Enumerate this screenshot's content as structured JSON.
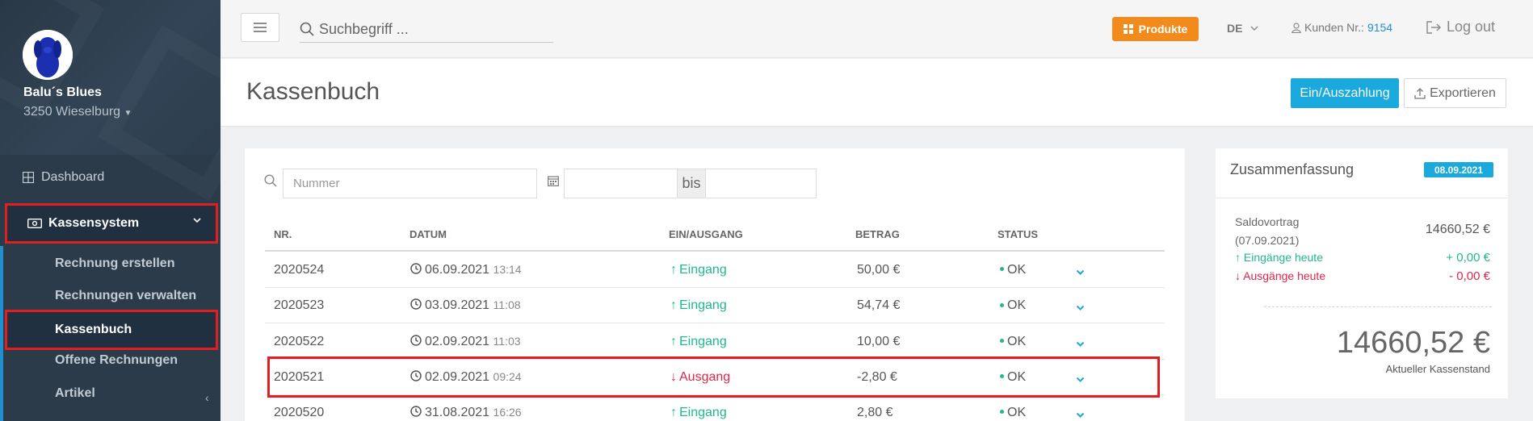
{
  "sidebar": {
    "shop_name": "Balu´s Blues",
    "shop_location": "3250 Wieselburg",
    "dashboard_label": "Dashboard",
    "kassensystem_label": "Kassensystem",
    "sub_items": [
      {
        "label": "Rechnung erstellen"
      },
      {
        "label": "Rechnungen verwalten"
      },
      {
        "label": "Kassenbuch"
      },
      {
        "label": "Offene Rechnungen"
      },
      {
        "label": "Artikel"
      }
    ]
  },
  "topbar": {
    "search_placeholder": "Suchbegriff ...",
    "produkte_label": "Produkte",
    "language": "DE",
    "kunden_label": "Kunden Nr.:",
    "kunden_nr": "9154",
    "logout_label": "Log out"
  },
  "page": {
    "title": "Kassenbuch",
    "ein_auszahlung_label": "Ein/Auszahlung",
    "exportieren_label": "Exportieren"
  },
  "filters": {
    "nummer_placeholder": "Nummer",
    "bis_label": "bis"
  },
  "table": {
    "columns": [
      "NR.",
      "DATUM",
      "EIN/AUSGANG",
      "BETRAG",
      "STATUS"
    ],
    "rows": [
      {
        "nr": "2020524",
        "date": "06.09.2021",
        "time": "13:14",
        "type": "Eingang",
        "direction": "in",
        "amount": "50,00 €",
        "status": "OK"
      },
      {
        "nr": "2020523",
        "date": "03.09.2021",
        "time": "11:08",
        "type": "Eingang",
        "direction": "in",
        "amount": "54,74 €",
        "status": "OK"
      },
      {
        "nr": "2020522",
        "date": "02.09.2021",
        "time": "11:03",
        "type": "Eingang",
        "direction": "in",
        "amount": "10,00 €",
        "status": "OK"
      },
      {
        "nr": "2020521",
        "date": "02.09.2021",
        "time": "09:24",
        "type": "Ausgang",
        "direction": "out",
        "amount": "-2,80 €",
        "status": "OK"
      },
      {
        "nr": "2020520",
        "date": "31.08.2021",
        "time": "16:26",
        "type": "Eingang",
        "direction": "in",
        "amount": "2,80 €",
        "status": "OK"
      }
    ]
  },
  "summary": {
    "title": "Zusammenfassung",
    "date_badge": "08.09.2021",
    "saldovortrag_label": "Saldovortrag",
    "saldovortrag_date": "(07.09.2021)",
    "saldovortrag_value": "14660,52 €",
    "eingaenge_label": "Eingänge heute",
    "eingaenge_value": "+ 0,00 €",
    "ausgaenge_label": "Ausgänge heute",
    "ausgaenge_value": "- 0,00 €",
    "kassenstand_value": "14660,52 €",
    "kassenstand_label": "Aktueller Kassenstand"
  },
  "colors": {
    "accent": "#19a9dd",
    "produkte": "#f28a1c",
    "eingang": "#20b890",
    "ausgang": "#e0264a",
    "highlight": "#e02020"
  }
}
